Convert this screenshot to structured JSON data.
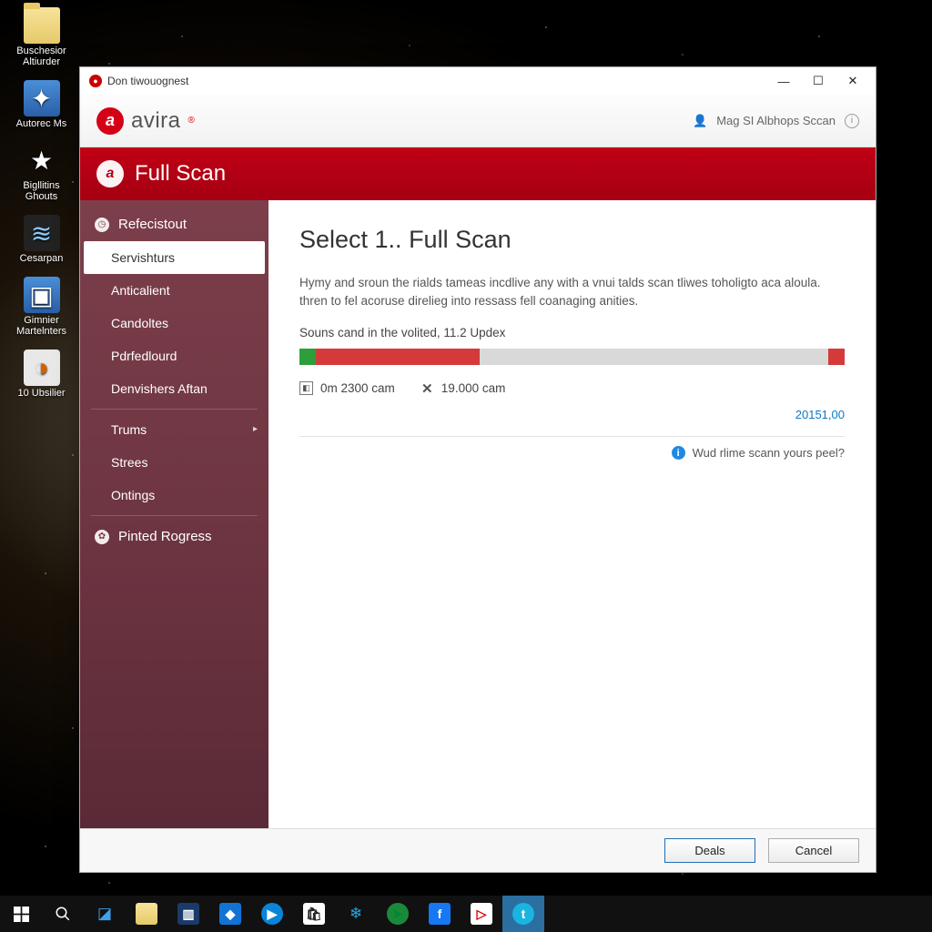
{
  "desktop_icons": [
    {
      "label": "Buschesior Altiurder"
    },
    {
      "label": "Autorec Ms"
    },
    {
      "label": "Bigllitins Ghouts"
    },
    {
      "label": "Cesarpan"
    },
    {
      "label": "Gimnier Martelnters"
    },
    {
      "label": "10 Ubsilier"
    }
  ],
  "window": {
    "title": "Don tiwouognest",
    "brand": "avira",
    "header_right": "Mag SI Albhops Sccan",
    "band_title": "Full Scan"
  },
  "sidebar": {
    "section1_head": "Refecistout",
    "items1": [
      "Servishturs",
      "Anticalient",
      "Candoltes",
      "Pdrfedlourd",
      "Denvishers Aftan"
    ],
    "items2": [
      "Trums",
      "Strees",
      "Ontings"
    ],
    "section2_head": "Pinted Rogress"
  },
  "main": {
    "heading": "Select 1.. Full Scan",
    "desc": "Hymy and sroun the rialds tameas incdlive any with a vnui talds scan tliwes toholigto aca aloula. thren to fel acoruse direlieg into ressass fell coanaging anities.",
    "subline": "Souns cand in the volited, 11.2 Updex",
    "stat1": "0m 2300 cam",
    "stat2": "19.000 cam",
    "right_link": "20151,00",
    "help_text": "Wud rlime scann yours peel?"
  },
  "footer": {
    "primary": "Deals",
    "cancel": "Cancel"
  }
}
